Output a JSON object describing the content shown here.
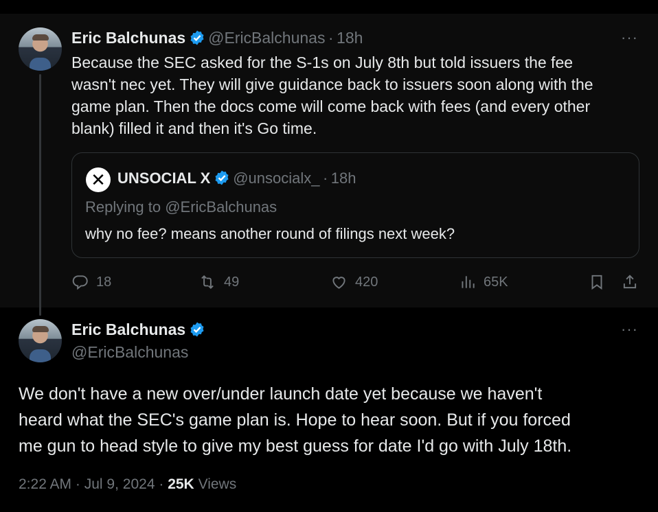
{
  "tweet1": {
    "author_name": "Eric Balchunas",
    "author_handle": "@EricBalchunas",
    "separator": "·",
    "time": "18h",
    "more": "···",
    "text_lines": [
      "Because the SEC asked for the S-1s on July 8th but told issuers the fee",
      "wasn't nec yet. They will give guidance back to issuers soon along with the",
      "game plan. Then the docs come will come back with fees (and every other",
      "blank) filled it and then it's Go time."
    ],
    "quote": {
      "author_name": "UNSOCIAL X",
      "author_handle": "@unsocialx_",
      "separator": "·",
      "time": "18h",
      "avatar_glyph": "✕",
      "replying_prefix": "Replying to",
      "replying_handle": "@EricBalchunas",
      "text": "why no fee? means another round of filings next week?"
    },
    "actions": {
      "replies": "18",
      "retweets": "49",
      "likes": "420",
      "views": "65K"
    }
  },
  "tweet2": {
    "author_name": "Eric Balchunas",
    "author_handle": "@EricBalchunas",
    "more": "···",
    "text_lines": [
      "We don't have a new over/under launch date yet because we haven't",
      "heard what the SEC's game plan is. Hope to hear soon. But if you forced",
      "me gun to head style to give my best guess for date I'd go with July 18th."
    ],
    "time": "2:22 AM",
    "dot1": "·",
    "date": "Jul 9, 2024",
    "dot2": "·",
    "views_count": "25K",
    "views_label": "Views"
  },
  "colors": {
    "verified": "#1d9bf0",
    "muted": "#71767b",
    "text": "#e7e9ea",
    "background": "#000000"
  }
}
